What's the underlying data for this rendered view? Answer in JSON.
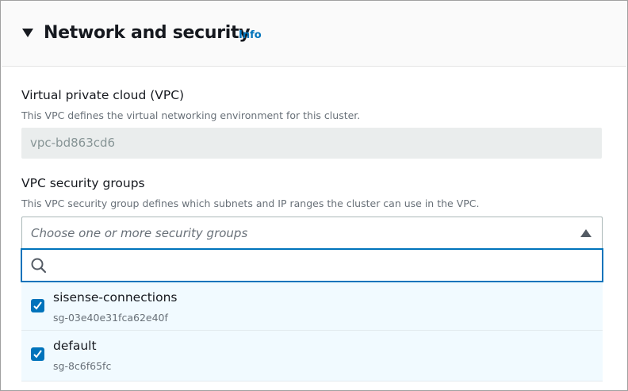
{
  "section": {
    "title": "Network and security",
    "info_link": "Info"
  },
  "vpc": {
    "label": "Virtual private cloud (VPC)",
    "description": "This VPC defines the virtual networking environment for this cluster.",
    "value": "vpc-bd863cd6"
  },
  "security_groups": {
    "label": "VPC security groups",
    "description": "This VPC security group defines which subnets and IP ranges the cluster can use in the VPC.",
    "placeholder": "Choose one or more security groups",
    "search_value": "",
    "options": [
      {
        "name": "sisense-connections",
        "id": "sg-03e40e31fca62e40f",
        "checked": true
      },
      {
        "name": "default",
        "id": "sg-8c6f65fc",
        "checked": true
      }
    ]
  }
}
